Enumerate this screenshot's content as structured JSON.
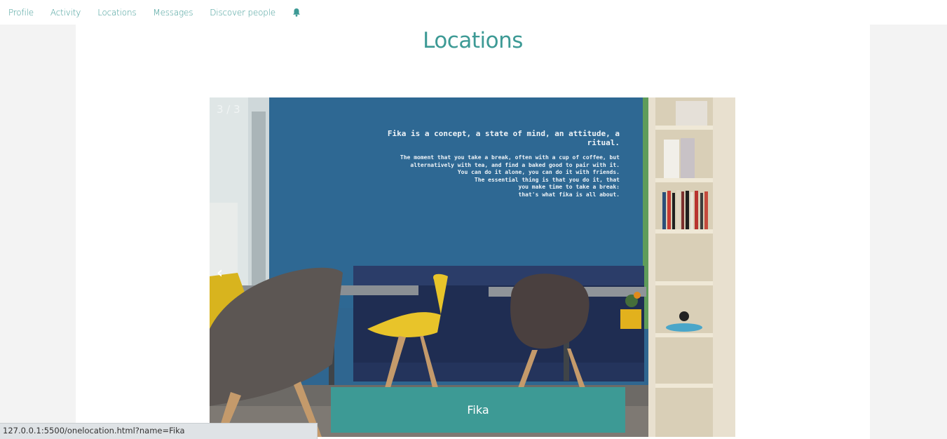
{
  "nav": {
    "links": [
      "Profile",
      "Activity",
      "Locations",
      "Messages",
      "Discover people"
    ],
    "bell_icon": "bell-icon"
  },
  "page": {
    "title": "Locations"
  },
  "slideshow": {
    "counter": "3 / 3",
    "prev_arrow": "‹",
    "caption": "Fika",
    "wall_text": {
      "headline": "Fika is a concept, a state of mind, an attitude, a ritual.",
      "lines": [
        "The moment that you take a break, often with a cup of coffee, but",
        "alternatively with tea, and find a baked good to pair with it.",
        "You can do it alone, you can do it with friends.",
        "The essential thing is that you do it, that",
        "you make time to take a break:",
        "that's what fika is all about."
      ]
    }
  },
  "status_bar": {
    "url": "127.0.0.1:5500/onelocation.html?name=Fika"
  },
  "colors": {
    "accent": "#3d9a95",
    "background": "#f3f3f3"
  }
}
